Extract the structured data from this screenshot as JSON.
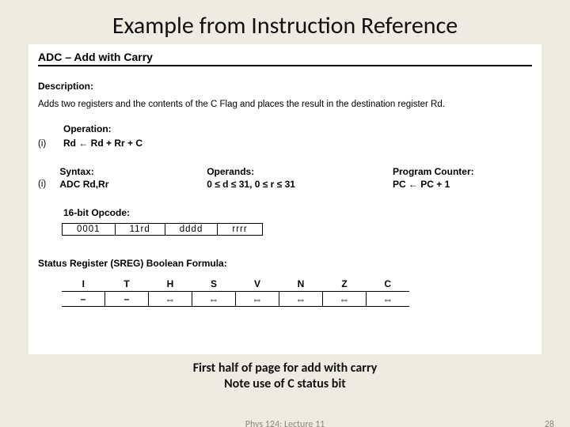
{
  "slide": {
    "title": "Example from Instruction Reference",
    "caption_line1": "First half of page for add with carry",
    "caption_line2": "Note use of C status bit",
    "footer_center": "Phys 124: Lecture 11",
    "page_number": "28"
  },
  "instr": {
    "header": "ADC – Add with Carry",
    "description_label": "Description:",
    "description_text": "Adds two registers and the contents of the C Flag and places the result in the destination register Rd.",
    "operation_label": "Operation:",
    "operation_roman": "(i)",
    "operation_formula": "Rd ← Rd + Rr + C",
    "syntax_label": "Syntax:",
    "operands_label": "Operands:",
    "pc_label": "Program Counter:",
    "syntax_roman": "(i)",
    "syntax_val": "ADC Rd,Rr",
    "operands_val": "0 ≤ d ≤ 31, 0 ≤ r ≤ 31",
    "pc_val": "PC ← PC + 1",
    "opcode_label": "16-bit Opcode:",
    "opcode_cells": [
      "0001",
      "11rd",
      "dddd",
      "rrrr"
    ],
    "sreg_label": "Status Register (SREG) Boolean Formula:",
    "sreg_headers": [
      "I",
      "T",
      "H",
      "S",
      "V",
      "N",
      "Z",
      "C"
    ],
    "sreg_values": [
      "–",
      "–",
      "⇔",
      "⇔",
      "⇔",
      "⇔",
      "⇔",
      "⇔"
    ]
  }
}
